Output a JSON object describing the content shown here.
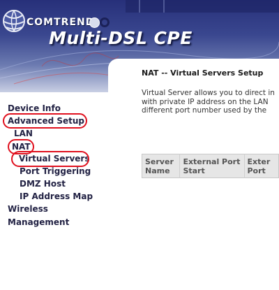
{
  "header": {
    "brand": "COMTREND",
    "product": "Multi-DSL CPE"
  },
  "sidebar": {
    "items": [
      {
        "label": "Device Info"
      },
      {
        "label": "Advanced Setup"
      },
      {
        "label": "LAN"
      },
      {
        "label": "NAT"
      },
      {
        "label": "Virtual Servers"
      },
      {
        "label": "Port Triggering"
      },
      {
        "label": "DMZ Host"
      },
      {
        "label": "IP Address Map"
      },
      {
        "label": "Wireless"
      },
      {
        "label": "Management"
      }
    ]
  },
  "main": {
    "title": "NAT -- Virtual Servers Setup",
    "description": [
      "Virtual Server allows you to direct in",
      "with private IP address on the LAN",
      "different port number used by the"
    ],
    "table": {
      "headers": [
        [
          "Server",
          "Name"
        ],
        [
          "External Port",
          "Start"
        ],
        [
          "Exter",
          "Port"
        ]
      ]
    }
  },
  "colors": {
    "highlight_ring": "#e0101e",
    "banner": "#27307a"
  }
}
